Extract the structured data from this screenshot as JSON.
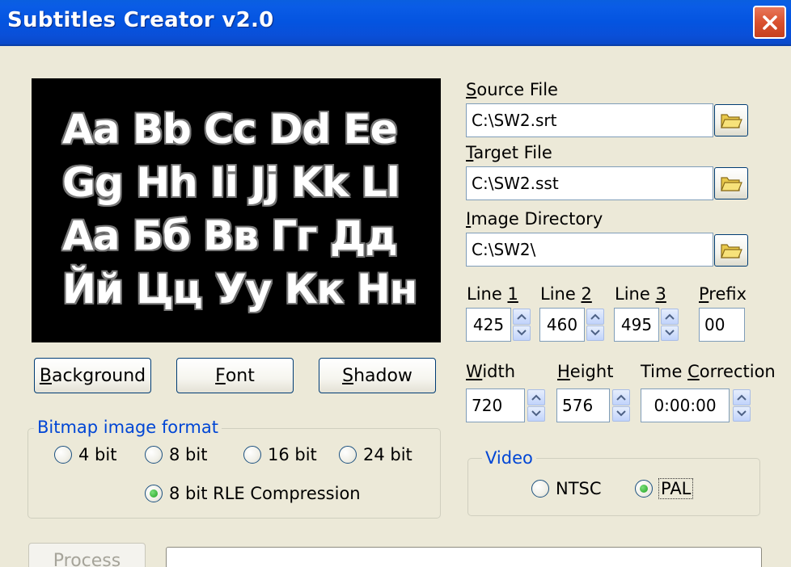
{
  "window": {
    "title": "Subtitles Creator v2.0"
  },
  "preview": {
    "lines": [
      "Aa Bb Cc Dd Ee",
      "Gg Hh Ii Jj Kk Ll",
      "Аа Бб Вв Гг Дд",
      "Йй Цц Уу Кк Нн"
    ]
  },
  "buttons": {
    "background": {
      "mnemonic": "B",
      "rest": "ackground"
    },
    "font": {
      "mnemonic": "F",
      "rest": "ont"
    },
    "shadow": {
      "mnemonic": "S",
      "rest": "hadow"
    },
    "process": "Process"
  },
  "bitmap_format": {
    "label": "Bitmap image format",
    "options": [
      "4 bit",
      "8 bit",
      "16 bit",
      "24 bit",
      "8 bit RLE Compression"
    ],
    "selected": "8 bit RLE Compression"
  },
  "source_file": {
    "mnemonic": "S",
    "rest": "ource File",
    "value": "C:\\SW2.srt"
  },
  "target_file": {
    "mnemonic": "T",
    "rest": "arget File",
    "value": "C:\\SW2.sst"
  },
  "image_directory": {
    "mnemonic": "I",
    "rest": "mage Directory",
    "value": "C:\\SW2\\"
  },
  "lines": {
    "line1": {
      "text": "Line ",
      "mnemonic": "1",
      "value": "425"
    },
    "line2": {
      "text": "Line ",
      "mnemonic": "2",
      "value": "460"
    },
    "line3": {
      "text": "Line ",
      "mnemonic": "3",
      "value": "495"
    },
    "prefix": {
      "mnemonic": "P",
      "rest": "refix",
      "value": "00"
    }
  },
  "dimensions": {
    "width": {
      "mnemonic": "W",
      "rest": "idth",
      "value": "720"
    },
    "height": {
      "mnemonic": "H",
      "rest": "eight",
      "value": "576"
    },
    "time_correction": {
      "before": "Time ",
      "mnemonic": "C",
      "rest": "orrection",
      "value": "0:00:00"
    }
  },
  "video": {
    "label": "Video",
    "options": [
      "NTSC",
      "PAL"
    ],
    "selected": "PAL"
  },
  "colors": {
    "titlebar": "#0454e0",
    "face": "#ece9d8",
    "group_label": "#0046d5",
    "close": "#d9512f"
  },
  "icons": [
    "close-icon",
    "folder-icon",
    "spin-up-icon",
    "spin-down-icon"
  ]
}
